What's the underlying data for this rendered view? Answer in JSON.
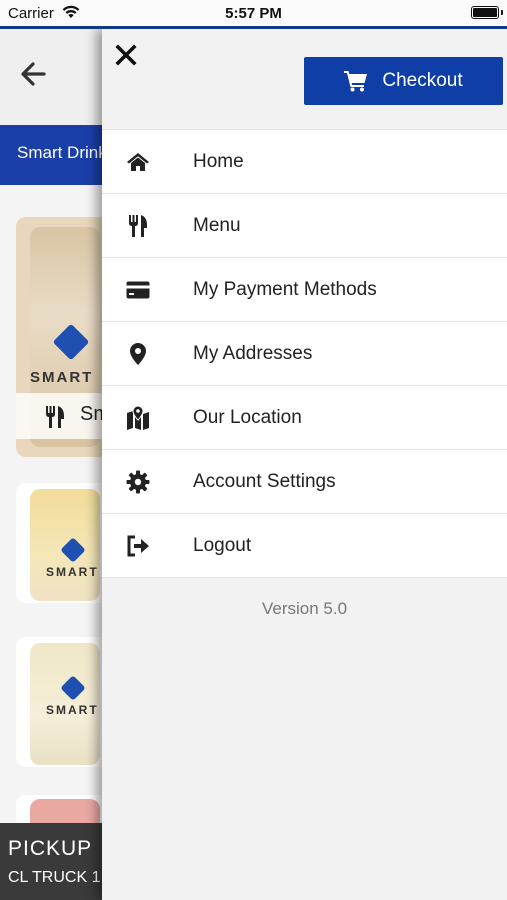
{
  "status_bar": {
    "carrier": "Carrier",
    "time": "5:57 PM"
  },
  "background": {
    "category_tab_label": "Smart Drinks",
    "visible_category_text": "Sm",
    "product_brand": "SMART",
    "pickup": {
      "mode": "PICKUP",
      "location": "CL TRUCK 1"
    }
  },
  "drawer": {
    "checkout_label": "Checkout",
    "menu_items": [
      {
        "label": "Home",
        "icon": "home-icon"
      },
      {
        "label": "Menu",
        "icon": "utensils-icon"
      },
      {
        "label": "My Payment Methods",
        "icon": "credit-card-icon"
      },
      {
        "label": "My Addresses",
        "icon": "map-marker-icon"
      },
      {
        "label": "Our Location",
        "icon": "map-location-icon"
      },
      {
        "label": "Account Settings",
        "icon": "gear-icon"
      },
      {
        "label": "Logout",
        "icon": "sign-out-icon"
      }
    ],
    "version": "Version 5.0"
  },
  "colors": {
    "primary_blue": "#0e3ea6",
    "tab_blue": "#1a3fa8",
    "pickup_bg": "#3a3a3a"
  }
}
